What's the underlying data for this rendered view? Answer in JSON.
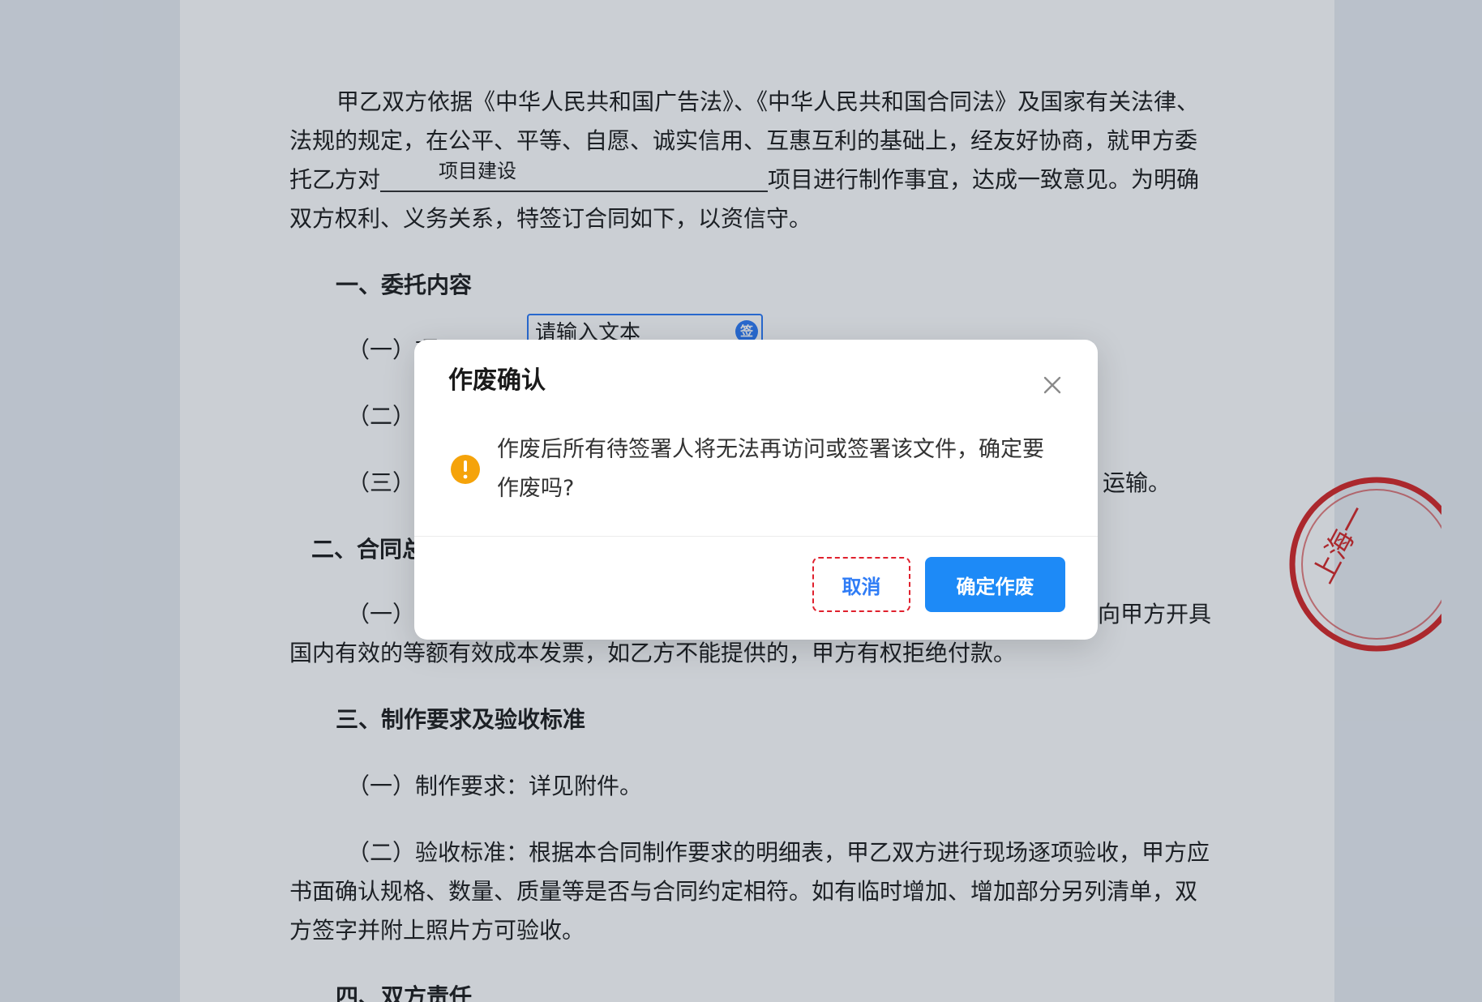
{
  "document": {
    "para1_line1": "甲乙双方依据《中华人民共和国广告法》、《中华人民共和国合同法》及国家有关法律、",
    "para1_line2": "法规的规定，在公平、平等、自愿、诚实信用、互惠互利的基础上，经友好协商，就甲方委",
    "para1_line3_prefix": "托乙方对",
    "blank_value": "项目建设",
    "para1_line3_suffix": "项目进行制作事宜，达成一致意见。为明确",
    "para1_line4": "双方权利、义务关系，特签订合同如下，以资信守。",
    "section1_heading": "一、委托内容",
    "item1_1": "（一）项",
    "item1_2": "（二）制",
    "item1_3_start": "（三）承",
    "item1_3_end": "运输。",
    "section2_heading": "二、合同总",
    "item2_1_start": "（一）本",
    "item2_1_end": "应向甲方开具",
    "item2_1_line2": "国内有效的等额有效成本发票，如乙方不能提供的，甲方有权拒绝付款。",
    "section3_heading": "三、制作要求及验收标准",
    "item3_1": "（一）制作要求：详见附件。",
    "item3_2_line1": "（二）验收标准：根据本合同制作要求的明细表，甲乙双方进行现场逐项验收，甲方应",
    "item3_2_line2": "书面确认规格、数量、质量等是否与合同约定相符。如有临时增加、增加部分另列清单，双",
    "item3_2_line3": "方签字并附上照片方可验收。",
    "section4_heading": "四、双方责任"
  },
  "text_field": {
    "placeholder": "请输入文本",
    "badge": "签"
  },
  "seal_text": "上海一",
  "modal": {
    "title": "作废确认",
    "message": "作废后所有待签署人将无法再访问或签署该文件，确定要作废吗?",
    "cancel_label": "取消",
    "confirm_label": "确定作废"
  },
  "colors": {
    "primary": "#1d8af7",
    "warning": "#f5a30a",
    "highlight_border": "#e0202d",
    "seal": "#d62a2a"
  }
}
